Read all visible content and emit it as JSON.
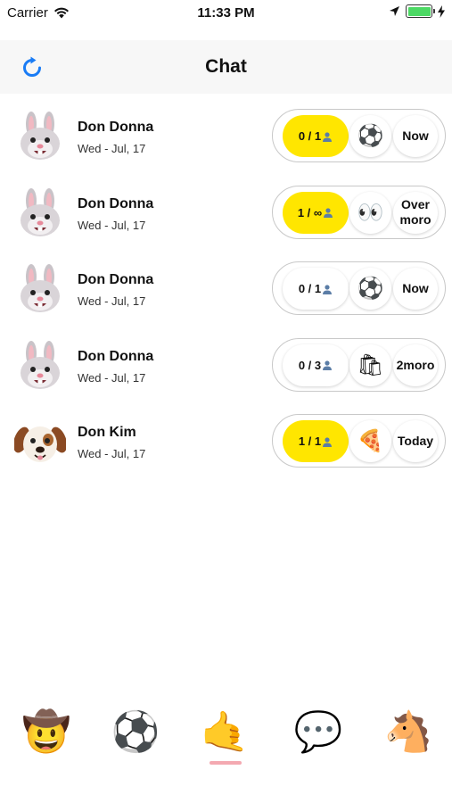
{
  "status_bar": {
    "carrier": "Carrier",
    "time": "11:33 PM"
  },
  "nav": {
    "title": "Chat"
  },
  "chats": [
    {
      "name": "Don Donna",
      "date": "Wed - Jul, 17",
      "avatar": "bunny-icon",
      "count": "0 / 1",
      "count_active": true,
      "activity": "soccer-ball-icon",
      "activity_glyph": "⚽",
      "when": "Now"
    },
    {
      "name": "Don Donna",
      "date": "Wed - Jul, 17",
      "avatar": "bunny-icon",
      "count": "1 / ∞",
      "count_active": true,
      "activity": "eyes-icon",
      "activity_glyph": "👀",
      "when": "Over moro"
    },
    {
      "name": "Don Donna",
      "date": "Wed - Jul, 17",
      "avatar": "bunny-icon",
      "count": "0 / 1",
      "count_active": false,
      "activity": "soccer-ball-icon",
      "activity_glyph": "⚽",
      "when": "Now"
    },
    {
      "name": "Don Donna",
      "date": "Wed - Jul, 17",
      "avatar": "bunny-icon",
      "count": "0 / 3",
      "count_active": false,
      "activity": "shopping-bags-icon",
      "activity_glyph": "🛍",
      "when": "2moro"
    },
    {
      "name": "Don Kim",
      "date": "Wed - Jul, 17",
      "avatar": "puppy-icon",
      "count": "1 / 1",
      "count_active": true,
      "activity": "pizza-icon",
      "activity_glyph": "🍕",
      "when": "Today"
    }
  ],
  "tabs": [
    {
      "icon": "cowboy-face-icon",
      "glyph": "🤠"
    },
    {
      "icon": "soccer-ball-icon",
      "glyph": "⚽"
    },
    {
      "icon": "call-me-hand-icon",
      "glyph": "🤙",
      "selected": true
    },
    {
      "icon": "speech-bubble-icon",
      "glyph": "💬"
    },
    {
      "icon": "horse-face-icon",
      "glyph": "🐴"
    }
  ],
  "colors": {
    "accent_yellow": "#ffe600",
    "refresh_blue": "#1a7cf5",
    "tab_indicator": "#f4a9b1",
    "battery_green": "#4cd964"
  }
}
